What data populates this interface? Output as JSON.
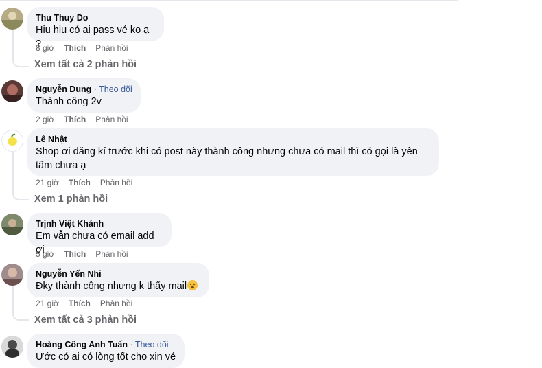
{
  "comments": [
    {
      "author": "Thu Thuy Do",
      "follow": "",
      "text": "Hiu hiu có ai pass vé ko ạ ?",
      "time": "8 giờ",
      "like": "Thích",
      "reply": "Phản hồi",
      "view_replies": "Xem tất cả 2 phản hồi"
    },
    {
      "author": "Nguyễn Dung",
      "follow": "Theo dõi",
      "text": "Thành công 2v",
      "time": "2 giờ",
      "like": "Thích",
      "reply": "Phản hồi",
      "view_replies": ""
    },
    {
      "author": "Lê Nhật",
      "follow": "",
      "text_line1": "Shop ơi đăng kí trước khi có post này thành công nhưng chưa có mail thì có gọi là yên",
      "text_line2": "tâm chưa ạ",
      "time": "21 giờ",
      "like": "Thích",
      "reply": "Phản hồi",
      "view_replies": "Xem 1 phản hồi"
    },
    {
      "author": "Trịnh Việt Khánh",
      "follow": "",
      "text": "Em vẫn chưa có email add ơi",
      "time": "5 giờ",
      "like": "Thích",
      "reply": "Phản hồi",
      "view_replies": ""
    },
    {
      "author": "Nguyễn Yến Nhi",
      "follow": "",
      "text": "Đky thành công nhưng k thấy mail",
      "emoji": "weary-face-emoji",
      "time": "21 giờ",
      "like": "Thích",
      "reply": "Phản hồi",
      "view_replies": "Xem tất cả 3 phản hồi"
    },
    {
      "author": "Hoàng Công Anh Tuấn",
      "follow": "Theo dõi",
      "text": "Ước có ai có lòng tốt cho xin vé",
      "time": "",
      "like": "",
      "reply": "",
      "view_replies": ""
    }
  ],
  "colors": {
    "bubble": "#f0f2f5",
    "meta": "#65676b",
    "follow": "#385898",
    "thread_line": "#e4e6eb"
  }
}
